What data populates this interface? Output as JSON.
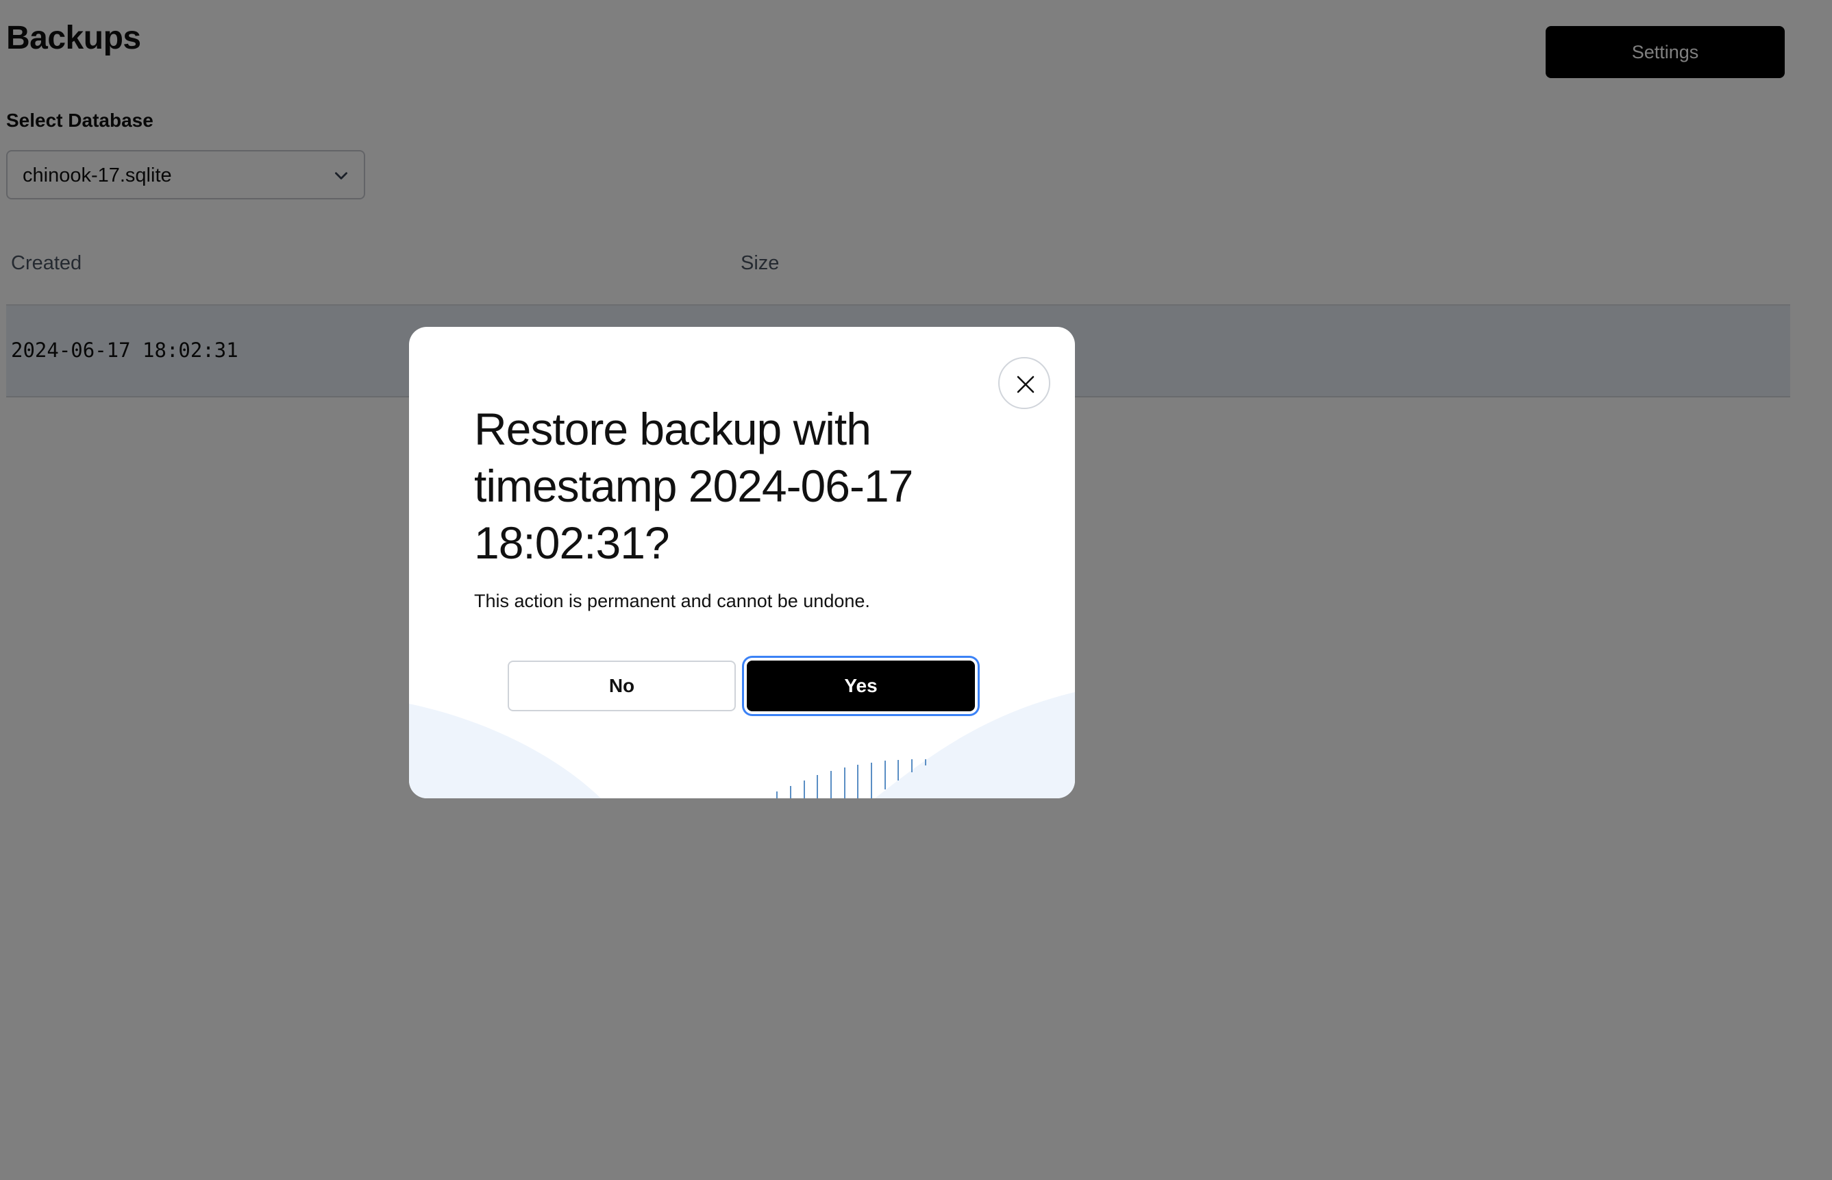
{
  "header": {
    "title": "Backups",
    "settings_label": "Settings"
  },
  "database_select": {
    "label": "Select Database",
    "value": "chinook-17.sqlite",
    "icon": "chevron-down-icon"
  },
  "table": {
    "columns": [
      "Created",
      "Size"
    ],
    "rows": [
      {
        "created": "2024-06-17 18:02:31",
        "size": ""
      }
    ]
  },
  "modal": {
    "title": "Restore backup with timestamp 2024-06-17 18:02:31?",
    "description": "This action is permanent and cannot be undone.",
    "no_label": "No",
    "yes_label": "Yes",
    "close_icon": "close-icon"
  },
  "colors": {
    "overlay": "#808080",
    "primary_button": "#000000",
    "focus_ring": "#3b82f6",
    "row_highlight": "#e6edf5",
    "modal_decoration": "#eef4fc",
    "decoration_lines": "#5a8ec4"
  }
}
